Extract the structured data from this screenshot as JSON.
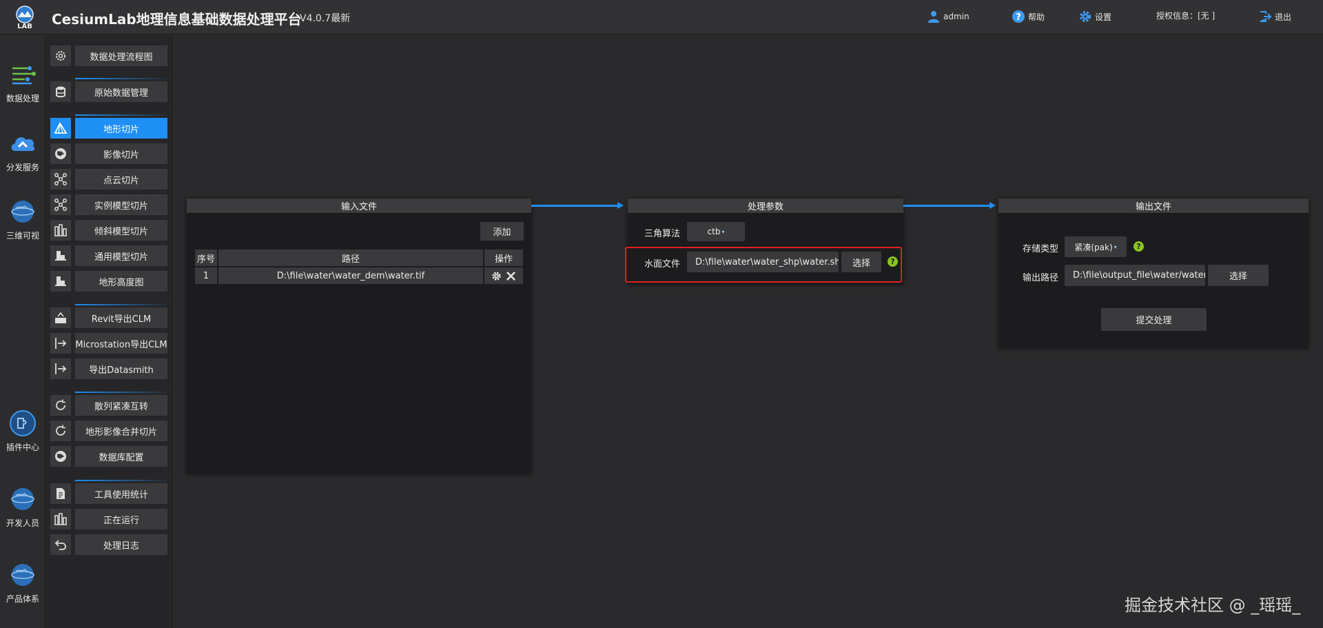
{
  "header": {
    "title": "CesiumLab地理信息基础数据处理平台",
    "version": "V4.0.7最新",
    "logo_text": "LAB",
    "user": "admin",
    "help": "帮助",
    "settings": "设置",
    "license": "授权信息：[无 ]",
    "logout": "退出"
  },
  "rail": {
    "items": [
      {
        "label": "数据处理",
        "icon": "data-process-icon"
      },
      {
        "label": "分发服务",
        "icon": "cloud-icon"
      },
      {
        "label": "三维可视",
        "icon": "earth-icon"
      },
      {
        "label": "插件中心",
        "icon": "plugin-icon"
      },
      {
        "label": "开发人员",
        "icon": "earth-icon"
      },
      {
        "label": "产品体系",
        "icon": "earth-icon"
      }
    ]
  },
  "menu": {
    "items": [
      {
        "label": "数据处理流程图",
        "icon": "gear-icon"
      },
      {
        "label": "原始数据管理",
        "icon": "database-icon"
      },
      {
        "label": "地形切片",
        "icon": "terrain-icon"
      },
      {
        "label": "影像切片",
        "icon": "globe-icon"
      },
      {
        "label": "点云切片",
        "icon": "point-cloud-icon"
      },
      {
        "label": "实例模型切片",
        "icon": "point-cloud-icon"
      },
      {
        "label": "倾斜模型切片",
        "icon": "building-icon"
      },
      {
        "label": "通用模型切片",
        "icon": "model-icon"
      },
      {
        "label": "地形高度图",
        "icon": "model-icon"
      },
      {
        "label": "Revit导出CLM",
        "icon": "export-icon"
      },
      {
        "label": "Microstation导出CLM",
        "icon": "export-arrow-icon"
      },
      {
        "label": "导出Datasmith",
        "icon": "export-arrow-icon"
      },
      {
        "label": "散列紧凑互转",
        "icon": "refresh-icon"
      },
      {
        "label": "地形影像合并切片",
        "icon": "refresh-icon"
      },
      {
        "label": "数据库配置",
        "icon": "globe-icon"
      },
      {
        "label": "工具使用统计",
        "icon": "document-icon"
      },
      {
        "label": "正在运行",
        "icon": "building-icon"
      },
      {
        "label": "处理日志",
        "icon": "undo-icon"
      }
    ]
  },
  "input_panel": {
    "title": "输入文件",
    "add_label": "添加",
    "columns": [
      "序号",
      "路径",
      "操作"
    ],
    "rows": [
      {
        "index": "1",
        "path": "D:\\file\\water\\water_dem\\water.tif"
      }
    ]
  },
  "params_panel": {
    "title": "处理参数",
    "algo_label": "三角算法",
    "algo_value": "ctb",
    "water_label": "水面文件",
    "water_value": "D:\\file\\water\\water_shp\\water.shp",
    "choose_label": "选择",
    "help_glyph": "?"
  },
  "output_panel": {
    "title": "输出文件",
    "storage_label": "存储类型",
    "storage_value": "紧凑(pak)",
    "path_label": "输出路径",
    "path_value": "D:\\file\\output_file\\water/water.pak",
    "choose_label": "选择",
    "submit_label": "提交处理",
    "help_glyph": "?"
  },
  "watermark": "掘金技术社区 @ _瑶瑶_",
  "colors": {
    "accent": "#1e8ff5",
    "highlight": "#e02020",
    "help": "#8ac420"
  }
}
